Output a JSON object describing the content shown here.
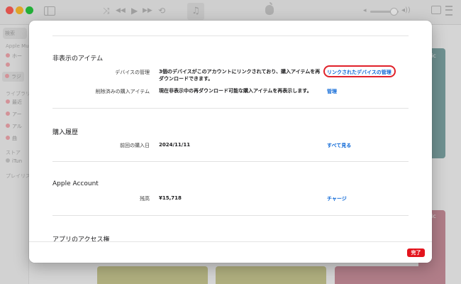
{
  "toolbar": {
    "shuffle_glyph": "⤨",
    "prev_glyph": "◀◀",
    "play_glyph": "▶",
    "next_glyph": "▶▶",
    "repeat_glyph": "⟲",
    "music_note_glyph": "♫",
    "volume_low_glyph": "◂",
    "volume_high_glyph": "◂))"
  },
  "sidebar": {
    "search_placeholder": "検索",
    "heading_apple_music": "Apple Mu",
    "item_home": "ホー",
    "item_radio": "ラジ",
    "heading_library": "ライブラリ",
    "item_recent": "最近",
    "item_artists": "アー",
    "item_albums": "アル",
    "item_songs": "曲",
    "heading_store": "ストア",
    "item_itunes": "iTun",
    "heading_playlists": "プレイリス"
  },
  "background": {
    "card_label_1": "sic",
    "card_label_2": "sic"
  },
  "sheet": {
    "hidden_items": {
      "title": "非表示のアイテム",
      "device_label": "デバイスの管理",
      "device_value_line1": "3個のデバイスがこのアカウントにリンクされており、購入アイテムを再",
      "device_value_line2": "ダウンロードできます。",
      "device_action": "リンクされたデバイスの管理",
      "deleted_label": "削除済みの購入アイテム",
      "deleted_value": "現在非表示中の再ダウンロード可能な購入アイテムを再表示します。",
      "deleted_action": "管理"
    },
    "purchase_history": {
      "title": "購入履歴",
      "last_purchase_label": "前回の購入日",
      "last_purchase_value": "2024/11/11",
      "action": "すべて見る"
    },
    "apple_account": {
      "title": "Apple Account",
      "balance_label": "残高",
      "balance_value": "¥15,718",
      "action": "チャージ"
    },
    "app_access": {
      "title": "アプリのアクセス権"
    },
    "done_label": "完了"
  },
  "colors": {
    "accent_link": "#0a66d6",
    "done_button": "#e3141d",
    "highlight_ring": "#e0212a"
  }
}
